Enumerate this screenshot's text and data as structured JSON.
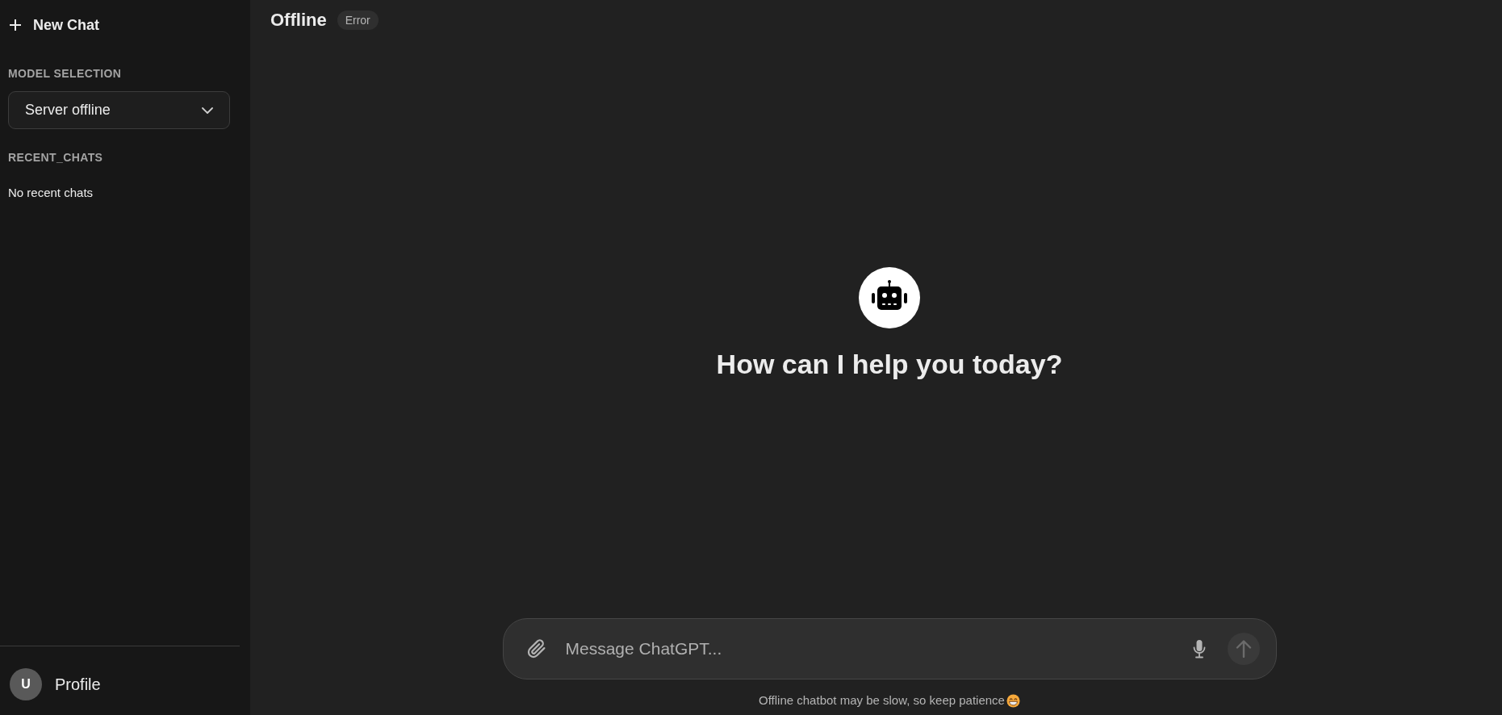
{
  "sidebar": {
    "new_chat": {
      "label": "New Chat"
    },
    "model_selection": {
      "heading": "MODEL SELECTION",
      "value": "Server offline"
    },
    "recent_chats": {
      "heading": "RECENT_CHATS",
      "empty_text": "No recent chats"
    },
    "profile": {
      "avatar_initial": "U",
      "label": "Profile"
    }
  },
  "header": {
    "title": "Offline",
    "badge": "Error"
  },
  "welcome": {
    "heading": "How can I help you today?"
  },
  "composer": {
    "placeholder": "Message ChatGPT...",
    "send_button": {
      "disabled": true
    }
  },
  "footer_note": "Offline chatbot may be slow, so keep patience"
}
